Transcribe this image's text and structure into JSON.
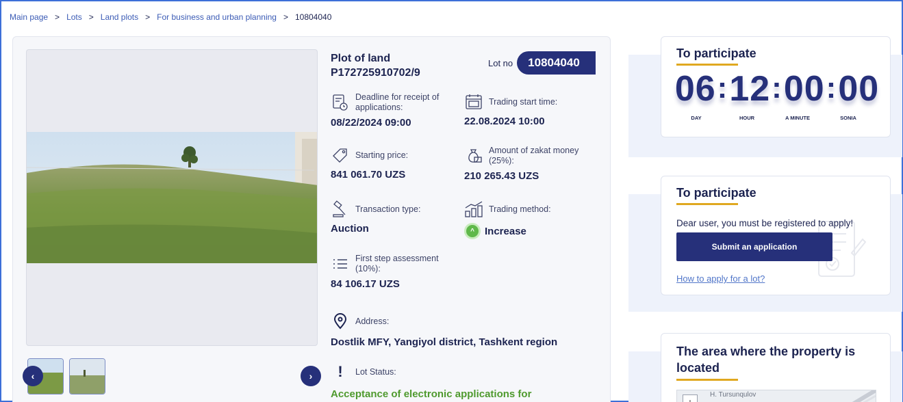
{
  "breadcrumb": {
    "items": [
      "Main page",
      "Lots",
      "Land plots",
      "For business and urban planning",
      "10804040"
    ],
    "separator": ">"
  },
  "lot": {
    "title_line1": "Plot of land",
    "title_line2": "P172725910702/9",
    "lot_no_label": "Lot no",
    "lot_no": "10804040"
  },
  "fields": {
    "deadline": {
      "label": "Deadline for receipt of applications:",
      "value": "08/22/2024 09:00",
      "icon": "document-clock-icon"
    },
    "trading_start": {
      "label": "Trading start time:",
      "value": "22.08.2024 10:00",
      "icon": "calendar-icon"
    },
    "starting_price": {
      "label": "Starting price:",
      "value": "841 061.70 UZS",
      "icon": "price-tag-icon"
    },
    "zakat": {
      "label": "Amount of zakat money (25%):",
      "value": "210 265.43 UZS",
      "icon": "money-bag-icon"
    },
    "transaction_type": {
      "label": "Transaction type:",
      "value": "Auction",
      "icon": "gavel-icon"
    },
    "trading_method": {
      "label": "Trading method:",
      "value": "Increase",
      "icon": "rising-chart-icon"
    },
    "first_step": {
      "label": "First step assessment (10%):",
      "value": "84 106.17 UZS",
      "icon": "list-icon"
    },
    "address": {
      "label": "Address:",
      "value": "Dostlik MFY, Yangiyol district, Tashkent region",
      "icon": "location-pin-icon"
    },
    "status": {
      "label": "Lot Status:",
      "value": "Acceptance of electronic applications for",
      "icon": "exclamation-icon"
    }
  },
  "countdown_card": {
    "title": "To participate",
    "days": "06",
    "hours": "12",
    "minutes": "00",
    "seconds": "00",
    "labels": [
      "DAY",
      "HOUR",
      "A MINUTE",
      "SONIA"
    ]
  },
  "apply_card": {
    "title": "To participate",
    "message": "Dear user, you must be registered to apply!",
    "submit_label": "Submit an application",
    "howto_label": "How to apply for a lot?"
  },
  "map_card": {
    "title": "The area where the property is located",
    "map_label": "H. Tursunqulov"
  },
  "colors": {
    "navy": "#26307a",
    "accent_underline": "#e0a820",
    "status_green": "#4f9a2e",
    "link_blue": "#5176c9"
  }
}
